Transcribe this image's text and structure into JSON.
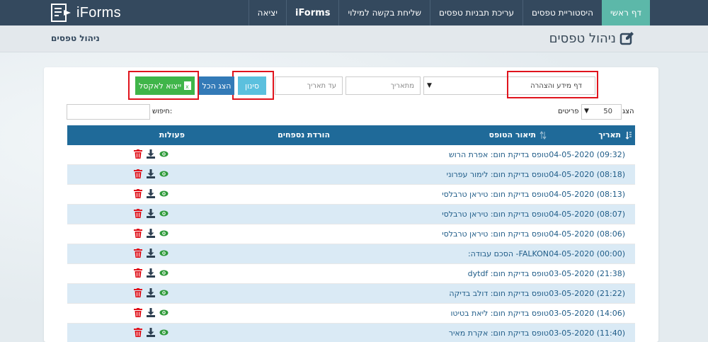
{
  "app": {
    "logo_text": "iForms"
  },
  "nav": {
    "items": [
      {
        "label": "דף ראשי",
        "active": true
      },
      {
        "label": "היסטוריית טפסים"
      },
      {
        "label": "עריכת תבניות טפסים"
      },
      {
        "label": "שליחת בקשה למילוי"
      },
      {
        "label": "iForms",
        "bold": true
      },
      {
        "label": "יציאה"
      }
    ]
  },
  "header": {
    "title": "ניהול טפסים",
    "breadcrumb": "ניהול טפסים"
  },
  "filters": {
    "form_select": "דף מידע והצהרה",
    "from_date_placeholder": "מתאריך",
    "to_date_placeholder": "עד תאריך",
    "filter_label": "סינון",
    "show_all_label": "הצג הכל",
    "export_label": "ייצוא לאקסל"
  },
  "paging": {
    "show_label": "הצג",
    "page_size": "50",
    "items_label": "פריטים",
    "search_label": "חיפוש:",
    "search_value": ""
  },
  "table": {
    "headers": {
      "date": "תאריך",
      "description": "תיאור הטופס",
      "attachments": "הורדת נספחים",
      "actions": "פעולות"
    },
    "rows": [
      {
        "date": "04-05-2020 (09:32)",
        "description": "טופס בדיקת חום: אפרת הרוש"
      },
      {
        "date": "04-05-2020 (08:18)",
        "description": "טופס בדיקת חום: לימור עפרוני"
      },
      {
        "date": "04-05-2020 (08:13)",
        "description": "טופס בדיקת חום: טיראן טרבלסי"
      },
      {
        "date": "04-05-2020 (08:07)",
        "description": "טופס בדיקת חום: טיראן טרבלסי"
      },
      {
        "date": "04-05-2020 (08:06)",
        "description": "טופס בדיקת חום: טיראן טרבלסי"
      },
      {
        "date": "04-05-2020 (00:00)",
        "description": "FALKON- הסכם עבודה:"
      },
      {
        "date": "03-05-2020 (21:38)",
        "description": "טופס בדיקת חום: dytdf"
      },
      {
        "date": "03-05-2020 (21:22)",
        "description": "טופס בדיקת חום: דולב בדיקה"
      },
      {
        "date": "03-05-2020 (14:06)",
        "description": "טופס בדיקת חום: ליאת בטיטו"
      },
      {
        "date": "03-05-2020 (11:40)",
        "description": "טופס בדיקת חום: אקרת מאיר"
      }
    ]
  },
  "colors": {
    "nav_bg": "#34495e",
    "nav_active": "#5cb8a9",
    "table_header": "#1f6a99",
    "row_alt": "#daeaf5",
    "highlight": "#e0141d",
    "export_btn": "#3fb549",
    "show_all_btn": "#337ab7",
    "filter_btn": "#5bc0de"
  }
}
